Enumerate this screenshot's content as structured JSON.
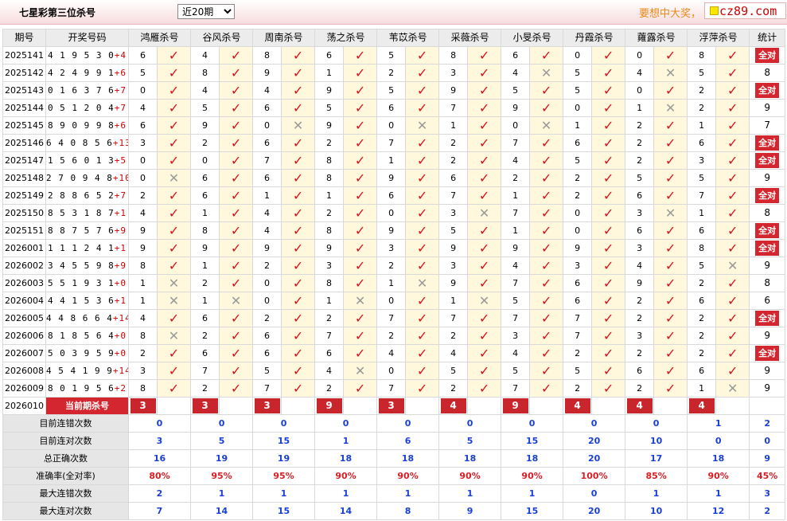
{
  "header": {
    "title": "七星彩第三位杀号",
    "period_select": "近20期",
    "slogan": "要想中大奖，",
    "site": "cz89.com"
  },
  "columns": [
    "期号",
    "开奖号码",
    "鸿雁杀号",
    "谷风杀号",
    "周南杀号",
    "荡之杀号",
    "苇苡杀号",
    "采薇杀号",
    "小旻杀号",
    "丹霞杀号",
    "蕹露杀号",
    "浮萍杀号",
    "统计"
  ],
  "all_correct_label": "全对",
  "rows": [
    {
      "period": "2025141",
      "win": "419530",
      "red": "+4",
      "preds": [
        [
          6,
          1
        ],
        [
          4,
          1
        ],
        [
          8,
          1
        ],
        [
          6,
          1
        ],
        [
          5,
          1
        ],
        [
          8,
          1
        ],
        [
          6,
          1
        ],
        [
          0,
          1
        ],
        [
          0,
          1
        ],
        [
          8,
          1
        ]
      ],
      "stat": "全对"
    },
    {
      "period": "2025142",
      "win": "424991",
      "red": "+6",
      "preds": [
        [
          5,
          1
        ],
        [
          8,
          1
        ],
        [
          9,
          1
        ],
        [
          1,
          1
        ],
        [
          2,
          1
        ],
        [
          3,
          1
        ],
        [
          4,
          0
        ],
        [
          5,
          1
        ],
        [
          4,
          0
        ],
        [
          5,
          1
        ]
      ],
      "stat": "8"
    },
    {
      "period": "2025143",
      "win": "016376",
      "red": "+7",
      "preds": [
        [
          0,
          1
        ],
        [
          4,
          1
        ],
        [
          4,
          1
        ],
        [
          9,
          1
        ],
        [
          5,
          1
        ],
        [
          9,
          1
        ],
        [
          5,
          1
        ],
        [
          5,
          1
        ],
        [
          0,
          1
        ],
        [
          2,
          1
        ]
      ],
      "stat": "全对"
    },
    {
      "period": "2025144",
      "win": "051204",
      "red": "+7",
      "preds": [
        [
          4,
          1
        ],
        [
          5,
          1
        ],
        [
          6,
          1
        ],
        [
          5,
          1
        ],
        [
          6,
          1
        ],
        [
          7,
          1
        ],
        [
          9,
          1
        ],
        [
          0,
          1
        ],
        [
          1,
          0
        ],
        [
          2,
          1
        ]
      ],
      "stat": "9"
    },
    {
      "period": "2025145",
      "win": "890998",
      "red": "+6",
      "preds": [
        [
          6,
          1
        ],
        [
          9,
          1
        ],
        [
          0,
          0
        ],
        [
          9,
          1
        ],
        [
          0,
          0
        ],
        [
          1,
          1
        ],
        [
          0,
          0
        ],
        [
          1,
          1
        ],
        [
          2,
          1
        ],
        [
          1,
          1
        ]
      ],
      "stat": "7"
    },
    {
      "period": "2025146",
      "win": "640856",
      "red": "+13",
      "preds": [
        [
          3,
          1
        ],
        [
          2,
          1
        ],
        [
          6,
          1
        ],
        [
          2,
          1
        ],
        [
          7,
          1
        ],
        [
          2,
          1
        ],
        [
          7,
          1
        ],
        [
          6,
          1
        ],
        [
          2,
          1
        ],
        [
          6,
          1
        ]
      ],
      "stat": "全对"
    },
    {
      "period": "2025147",
      "win": "156013",
      "red": "+5",
      "preds": [
        [
          0,
          1
        ],
        [
          0,
          1
        ],
        [
          7,
          1
        ],
        [
          8,
          1
        ],
        [
          1,
          1
        ],
        [
          2,
          1
        ],
        [
          4,
          1
        ],
        [
          5,
          1
        ],
        [
          2,
          1
        ],
        [
          3,
          1
        ]
      ],
      "stat": "全对"
    },
    {
      "period": "2025148",
      "win": "270948",
      "red": "+10",
      "preds": [
        [
          0,
          0
        ],
        [
          6,
          1
        ],
        [
          6,
          1
        ],
        [
          8,
          1
        ],
        [
          9,
          1
        ],
        [
          6,
          1
        ],
        [
          2,
          1
        ],
        [
          2,
          1
        ],
        [
          5,
          1
        ],
        [
          5,
          1
        ]
      ],
      "stat": "9"
    },
    {
      "period": "2025149",
      "win": "288652",
      "red": "+7",
      "preds": [
        [
          2,
          1
        ],
        [
          6,
          1
        ],
        [
          1,
          1
        ],
        [
          1,
          1
        ],
        [
          6,
          1
        ],
        [
          7,
          1
        ],
        [
          1,
          1
        ],
        [
          2,
          1
        ],
        [
          6,
          1
        ],
        [
          7,
          1
        ]
      ],
      "stat": "全对"
    },
    {
      "period": "2025150",
      "win": "853187",
      "red": "+1",
      "preds": [
        [
          4,
          1
        ],
        [
          1,
          1
        ],
        [
          4,
          1
        ],
        [
          2,
          1
        ],
        [
          0,
          1
        ],
        [
          3,
          0
        ],
        [
          7,
          1
        ],
        [
          0,
          1
        ],
        [
          3,
          0
        ],
        [
          1,
          1
        ]
      ],
      "stat": "8"
    },
    {
      "period": "2025151",
      "win": "887576",
      "red": "+9",
      "preds": [
        [
          9,
          1
        ],
        [
          8,
          1
        ],
        [
          4,
          1
        ],
        [
          8,
          1
        ],
        [
          9,
          1
        ],
        [
          5,
          1
        ],
        [
          1,
          1
        ],
        [
          0,
          1
        ],
        [
          6,
          1
        ],
        [
          6,
          1
        ]
      ],
      "stat": "全对"
    },
    {
      "period": "2026001",
      "win": "111241",
      "red": "+1",
      "preds": [
        [
          9,
          1
        ],
        [
          9,
          1
        ],
        [
          9,
          1
        ],
        [
          9,
          1
        ],
        [
          3,
          1
        ],
        [
          9,
          1
        ],
        [
          9,
          1
        ],
        [
          9,
          1
        ],
        [
          3,
          1
        ],
        [
          8,
          1
        ]
      ],
      "stat": "全对"
    },
    {
      "period": "2026002",
      "win": "345598",
      "red": "+9",
      "preds": [
        [
          8,
          1
        ],
        [
          1,
          1
        ],
        [
          2,
          1
        ],
        [
          3,
          1
        ],
        [
          2,
          1
        ],
        [
          3,
          1
        ],
        [
          4,
          1
        ],
        [
          3,
          1
        ],
        [
          4,
          1
        ],
        [
          5,
          0
        ]
      ],
      "stat": "9"
    },
    {
      "period": "2026003",
      "win": "551931",
      "red": "+0",
      "preds": [
        [
          1,
          0
        ],
        [
          2,
          1
        ],
        [
          0,
          1
        ],
        [
          8,
          1
        ],
        [
          1,
          0
        ],
        [
          9,
          1
        ],
        [
          7,
          1
        ],
        [
          6,
          1
        ],
        [
          9,
          1
        ],
        [
          2,
          1
        ]
      ],
      "stat": "8"
    },
    {
      "period": "2026004",
      "win": "441536",
      "red": "+1",
      "preds": [
        [
          1,
          0
        ],
        [
          1,
          0
        ],
        [
          0,
          1
        ],
        [
          1,
          0
        ],
        [
          0,
          1
        ],
        [
          1,
          0
        ],
        [
          5,
          1
        ],
        [
          6,
          1
        ],
        [
          2,
          1
        ],
        [
          6,
          1
        ]
      ],
      "stat": "6"
    },
    {
      "period": "2026005",
      "win": "448664",
      "red": "+14",
      "preds": [
        [
          4,
          1
        ],
        [
          6,
          1
        ],
        [
          2,
          1
        ],
        [
          2,
          1
        ],
        [
          7,
          1
        ],
        [
          7,
          1
        ],
        [
          7,
          1
        ],
        [
          7,
          1
        ],
        [
          2,
          1
        ],
        [
          2,
          1
        ]
      ],
      "stat": "全对"
    },
    {
      "period": "2026006",
      "win": "818564",
      "red": "+0",
      "preds": [
        [
          8,
          0
        ],
        [
          2,
          1
        ],
        [
          6,
          1
        ],
        [
          7,
          1
        ],
        [
          2,
          1
        ],
        [
          2,
          1
        ],
        [
          3,
          1
        ],
        [
          7,
          1
        ],
        [
          3,
          1
        ],
        [
          2,
          1
        ]
      ],
      "stat": "9"
    },
    {
      "period": "2026007",
      "win": "503959",
      "red": "+0",
      "preds": [
        [
          2,
          1
        ],
        [
          6,
          1
        ],
        [
          6,
          1
        ],
        [
          6,
          1
        ],
        [
          4,
          1
        ],
        [
          4,
          1
        ],
        [
          4,
          1
        ],
        [
          2,
          1
        ],
        [
          2,
          1
        ],
        [
          2,
          1
        ]
      ],
      "stat": "全对"
    },
    {
      "period": "2026008",
      "win": "454199",
      "red": "+14",
      "preds": [
        [
          3,
          1
        ],
        [
          7,
          1
        ],
        [
          5,
          1
        ],
        [
          4,
          0
        ],
        [
          0,
          1
        ],
        [
          5,
          1
        ],
        [
          5,
          1
        ],
        [
          5,
          1
        ],
        [
          6,
          1
        ],
        [
          6,
          1
        ]
      ],
      "stat": "9"
    },
    {
      "period": "2026009",
      "win": "801956",
      "red": "+2",
      "preds": [
        [
          8,
          1
        ],
        [
          2,
          1
        ],
        [
          7,
          1
        ],
        [
          2,
          1
        ],
        [
          7,
          1
        ],
        [
          2,
          1
        ],
        [
          7,
          1
        ],
        [
          2,
          1
        ],
        [
          2,
          1
        ],
        [
          1,
          0
        ]
      ],
      "stat": "9"
    }
  ],
  "current": {
    "period": "2026010",
    "label": "当前期杀号",
    "values": [
      3,
      3,
      3,
      9,
      3,
      4,
      9,
      4,
      4,
      4
    ]
  },
  "summary": [
    {
      "label": "目前连错次数",
      "values": [
        "0",
        "0",
        "0",
        "0",
        "0",
        "0",
        "0",
        "0",
        "0",
        "1"
      ],
      "stat": "2",
      "color": "blue",
      "stat_color": "blue"
    },
    {
      "label": "目前连对次数",
      "values": [
        "3",
        "5",
        "15",
        "1",
        "6",
        "5",
        "15",
        "20",
        "10",
        "0"
      ],
      "stat": "0",
      "color": "blue",
      "stat_color": "blue"
    },
    {
      "label": "总正确次数",
      "values": [
        "16",
        "19",
        "19",
        "18",
        "18",
        "18",
        "18",
        "20",
        "17",
        "18"
      ],
      "stat": "9",
      "color": "blue",
      "stat_color": "blue"
    },
    {
      "label": "准确率(全对率)",
      "values": [
        "80%",
        "95%",
        "95%",
        "90%",
        "90%",
        "90%",
        "90%",
        "100%",
        "85%",
        "90%"
      ],
      "stat": "45%",
      "color": "red",
      "stat_color": "red"
    },
    {
      "label": "最大连错次数",
      "values": [
        "2",
        "1",
        "1",
        "1",
        "1",
        "1",
        "1",
        "0",
        "1",
        "1"
      ],
      "stat": "3",
      "color": "blue",
      "stat_color": "blue"
    },
    {
      "label": "最大连对次数",
      "values": [
        "7",
        "14",
        "15",
        "14",
        "8",
        "9",
        "15",
        "20",
        "10",
        "12"
      ],
      "stat": "2",
      "color": "blue",
      "stat_color": "blue"
    }
  ],
  "marks": {
    "correct": "✓",
    "wrong": "✕"
  },
  "colors": {
    "accent_red": "#d4262e",
    "correct_mark": "#e0101c",
    "wrong_mark": "#9a9a9a",
    "summary_blue": "#1a3fd8",
    "highlight": "#fff8dd"
  }
}
